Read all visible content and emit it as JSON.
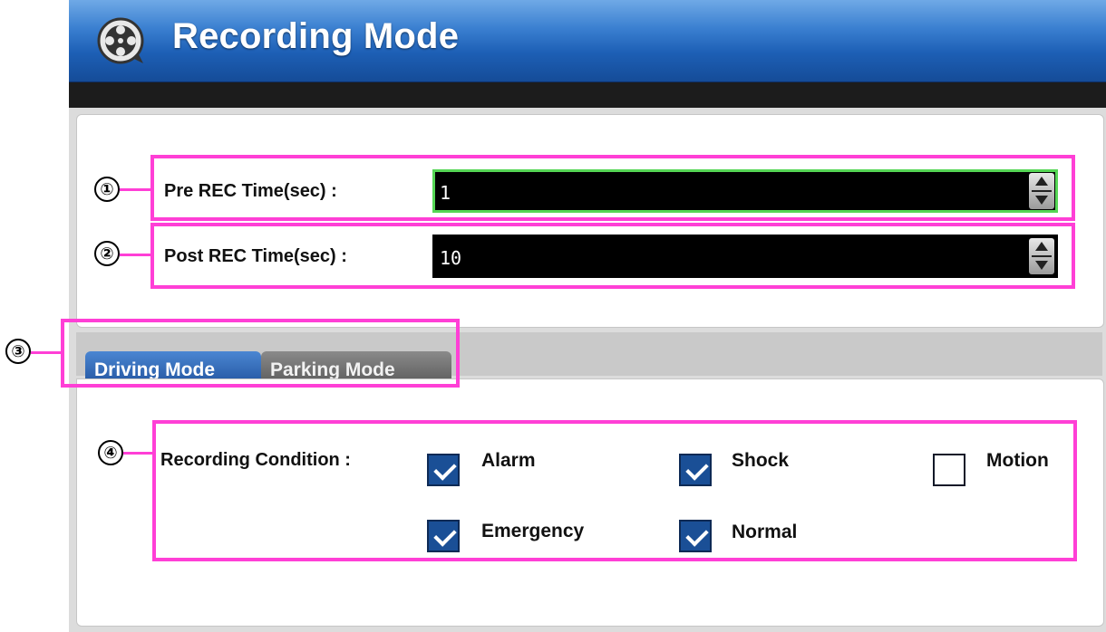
{
  "window": {
    "title": "Recording Mode",
    "icon": "film-reel-icon"
  },
  "settings": {
    "pre_rec": {
      "label": "Pre REC Time(sec) :",
      "value": "1"
    },
    "post_rec": {
      "label": "Post REC Time(sec) :",
      "value": "10"
    }
  },
  "tabs": [
    {
      "label": "Driving Mode",
      "active": true
    },
    {
      "label": "Parking Mode",
      "active": false
    }
  ],
  "recording_condition": {
    "label": "Recording Condition :",
    "options": [
      {
        "label": "Alarm",
        "checked": true
      },
      {
        "label": "Shock",
        "checked": true
      },
      {
        "label": "Motion",
        "checked": false
      },
      {
        "label": "Emergency",
        "checked": true
      },
      {
        "label": "Normal",
        "checked": true
      }
    ]
  },
  "annotations": [
    "①",
    "②",
    "③",
    "④"
  ],
  "colors": {
    "header_blue": "#1d5fb5",
    "annotation_magenta": "#ff3fd6",
    "checkbox_checked": "#1a4f96",
    "spin_focus_green": "#55d655"
  }
}
